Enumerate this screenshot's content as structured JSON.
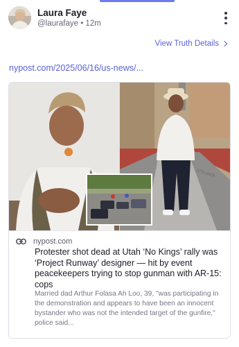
{
  "author": {
    "name": "Laura Faye",
    "handle": "@laurafaye",
    "separator": "•",
    "time": "12m"
  },
  "actions": {
    "truth_details": "View Truth Details",
    "more_icon": "more-vertical-icon"
  },
  "post": {
    "link_text": "nypost.com/2025/06/16/us-news/..."
  },
  "card": {
    "source": "nypost.com",
    "headline": "Protester shot dead at Utah ‘No Kings’ rally was ‘Project Runway’ designer — hit by event peacekeepers trying to stop gunman with AR-15: cops",
    "excerpt": "Married dad Arthur Folasa Ah Loo, 39, \"was participating in the demonstration and appears to have been an innocent bystander who was not the intended target of the gunfire,\" police said...",
    "image_text": "STEGNER",
    "link_icon": "link-icon"
  },
  "colors": {
    "accent": "#5a62d8",
    "muted_text": "#767684"
  }
}
